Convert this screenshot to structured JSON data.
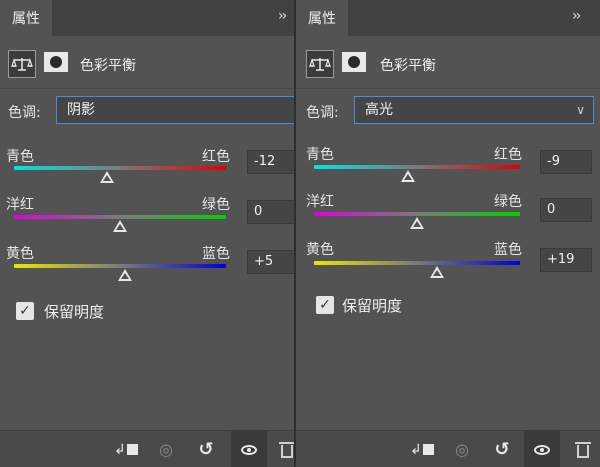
{
  "panels": [
    {
      "tab_label": "属性",
      "collapse_glyph": "››",
      "adjustment_title": "色彩平衡",
      "tone_label": "色调:",
      "tone_value": "阴影",
      "sliders": [
        {
          "left": "青色",
          "right": "红色",
          "value": "-12",
          "level": -12
        },
        {
          "left": "洋红",
          "right": "绿色",
          "value": "0",
          "level": 0
        },
        {
          "left": "黄色",
          "right": "蓝色",
          "value": "+5",
          "level": 5
        }
      ],
      "preserve_label": "保留明度",
      "preserve_checked": true
    },
    {
      "tab_label": "属性",
      "collapse_glyph": "››",
      "adjustment_title": "色彩平衡",
      "tone_label": "色调:",
      "tone_value": "高光",
      "sliders": [
        {
          "left": "青色",
          "right": "红色",
          "value": "-9",
          "level": -9
        },
        {
          "left": "洋红",
          "right": "绿色",
          "value": "0",
          "level": 0
        },
        {
          "left": "黄色",
          "right": "蓝色",
          "value": "+19",
          "level": 19
        }
      ],
      "preserve_label": "保留明度",
      "preserve_checked": true
    }
  ],
  "icons": {
    "adjustment": "balance-scale-icon",
    "mask": "layer-mask-icon",
    "clip": "clip-to-layer-icon",
    "view_previous": "view-previous-state-icon",
    "reset": "reset-icon",
    "visibility": "eye-icon",
    "delete": "trash-icon",
    "dropdown": "chevron-down-icon",
    "panel_menu": "panel-menu-icon"
  },
  "colors": {
    "panel_bg": "#535353",
    "select_border": "#4a8cd6"
  }
}
